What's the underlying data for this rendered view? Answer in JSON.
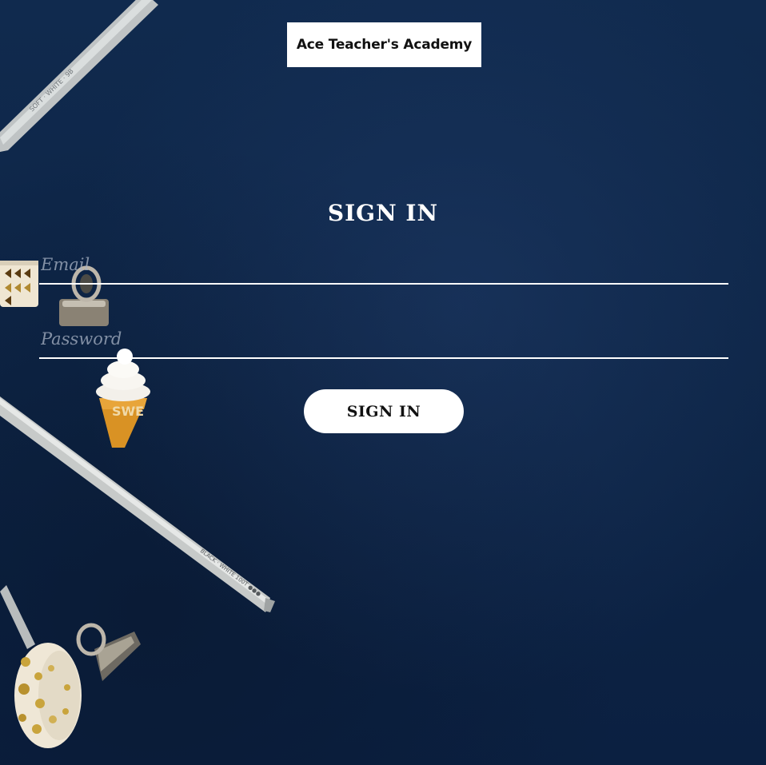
{
  "brand": {
    "name": "Ace Teacher's Academy"
  },
  "form": {
    "title": "SIGN IN",
    "email_placeholder": "Email",
    "password_placeholder": "Password",
    "submit_label": "SIGN IN"
  },
  "colors": {
    "background": "#0f2748",
    "foreground": "#ffffff",
    "button_background": "#ffffff",
    "button_text": "#111111",
    "placeholder": "#aab4c6"
  }
}
